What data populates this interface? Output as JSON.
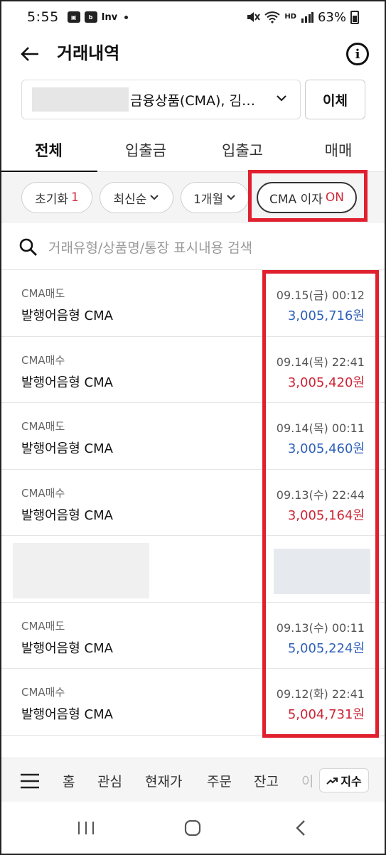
{
  "status_bar": {
    "time": "5:55",
    "icons": [
      "gallery-icon",
      "blog-icon",
      "inv-icon"
    ],
    "network": "HD",
    "battery": "63%"
  },
  "header": {
    "title": "거래내역"
  },
  "account": {
    "label": "금융상품(CMA), 김…",
    "transfer_label": "이체"
  },
  "tabs": [
    {
      "label": "전체",
      "active": true
    },
    {
      "label": "입출금"
    },
    {
      "label": "입출고"
    },
    {
      "label": "매매"
    }
  ],
  "filters": {
    "reset_label": "초기화",
    "reset_count": "1",
    "sort_label": "최신순",
    "period_label": "1개월",
    "cma_label": "CMA 이자",
    "cma_state": "ON"
  },
  "search": {
    "placeholder": "거래유형/상품명/통장 표시내용 검색"
  },
  "transactions": [
    {
      "type": "CMA매도",
      "name": "발행어음형 CMA",
      "date": "09.15(금) 00:12",
      "amount": "3,005,716원",
      "color": "blue"
    },
    {
      "type": "CMA매수",
      "name": "발행어음형 CMA",
      "date": "09.14(목) 22:41",
      "amount": "3,005,420원",
      "color": "red"
    },
    {
      "type": "CMA매도",
      "name": "발행어음형 CMA",
      "date": "09.14(목) 00:11",
      "amount": "3,005,460원",
      "color": "blue"
    },
    {
      "type": "CMA매수",
      "name": "발행어음형 CMA",
      "date": "09.13(수) 22:44",
      "amount": "3,005,164원",
      "color": "red"
    },
    {
      "type": "CMA매도",
      "name": "발행어음형 CMA",
      "date": "09.13(수) 00:11",
      "amount": "5,005,224원",
      "color": "blue"
    },
    {
      "type": "CMA매수",
      "name": "발행어음형 CMA",
      "date": "09.12(화) 22:41",
      "amount": "5,004,731원",
      "color": "red"
    }
  ],
  "bottom_nav": {
    "items": [
      "홈",
      "관심",
      "현재가",
      "주문",
      "잔고",
      "이"
    ],
    "index_label": "지수"
  },
  "colors": {
    "highlight": "#e0202e",
    "sell": "#2e5fb8",
    "buy": "#cc2434"
  }
}
